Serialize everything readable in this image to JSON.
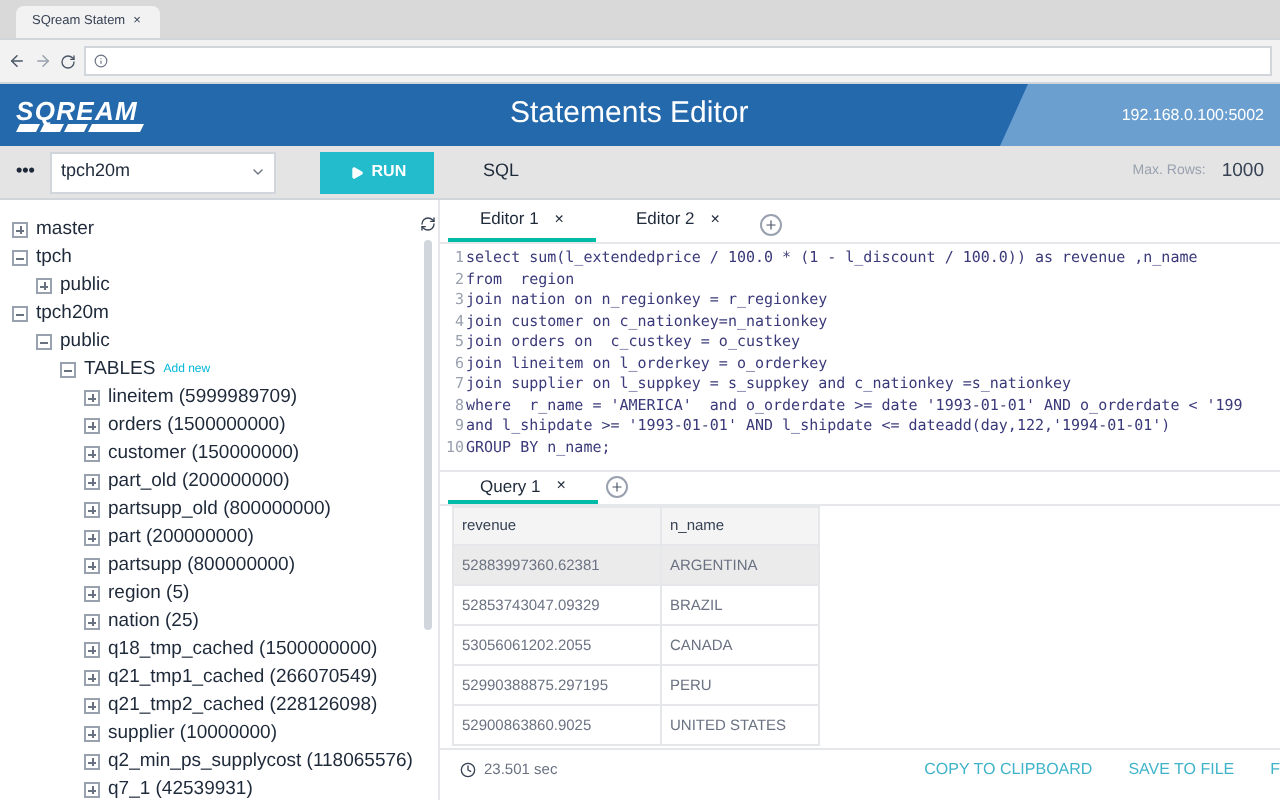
{
  "browser": {
    "tab_title": "SQream Statem",
    "close": "×"
  },
  "header": {
    "logo": "SQREAM",
    "title": "Statements Editor",
    "host": "192.168.0.100:5002"
  },
  "toolbar": {
    "more": "•••",
    "database": "tpch20m",
    "run": "RUN",
    "mode": "SQL",
    "max_rows_label": "Max. Rows:",
    "max_rows": "1000"
  },
  "tree": [
    {
      "label": "master",
      "expanded": false
    },
    {
      "label": "tpch",
      "expanded": true,
      "children": [
        {
          "label": "public",
          "expanded": false
        }
      ]
    },
    {
      "label": "tpch20m",
      "expanded": true,
      "children": [
        {
          "label": "public",
          "expanded": true,
          "children": [
            {
              "label": "TABLES",
              "link": "Add new",
              "expanded": true,
              "children": [
                {
                  "label": "lineitem (5999989709)",
                  "expanded": false
                },
                {
                  "label": "orders (1500000000)",
                  "expanded": false
                },
                {
                  "label": "customer (150000000)",
                  "expanded": false
                },
                {
                  "label": "part_old (200000000)",
                  "expanded": false
                },
                {
                  "label": "partsupp_old (800000000)",
                  "expanded": false
                },
                {
                  "label": "part (200000000)",
                  "expanded": false
                },
                {
                  "label": "partsupp (800000000)",
                  "expanded": false
                },
                {
                  "label": "region (5)",
                  "expanded": false
                },
                {
                  "label": "nation (25)",
                  "expanded": false
                },
                {
                  "label": "q18_tmp_cached (1500000000)",
                  "expanded": false
                },
                {
                  "label": "q21_tmp1_cached (266070549)",
                  "expanded": false
                },
                {
                  "label": "q21_tmp2_cached (228126098)",
                  "expanded": false
                },
                {
                  "label": "supplier (10000000)",
                  "expanded": false
                },
                {
                  "label": "q2_min_ps_supplycost (118065576)",
                  "expanded": false
                },
                {
                  "label": "q7_1 (42539931)",
                  "expanded": false
                }
              ]
            }
          ]
        }
      ]
    }
  ],
  "editor_tabs": [
    {
      "label": "Editor 1",
      "close": "×",
      "selected": true
    },
    {
      "label": "Editor 2",
      "close": "×",
      "selected": false
    }
  ],
  "code": [
    {
      "n": "1",
      "text": "select sum(l_extendedprice / 100.0 * (1 - l_discount / 100.0)) as revenue ,n_name"
    },
    {
      "n": "2",
      "text": "from  region"
    },
    {
      "n": "3",
      "text": "join nation on n_regionkey = r_regionkey"
    },
    {
      "n": "4",
      "text": "join customer on c_nationkey=n_nationkey"
    },
    {
      "n": "5",
      "text": "join orders on  c_custkey = o_custkey"
    },
    {
      "n": "6",
      "text": "join lineitem on l_orderkey = o_orderkey"
    },
    {
      "n": "7",
      "text": "join supplier on l_suppkey = s_suppkey and c_nationkey =s_nationkey"
    },
    {
      "n": "8",
      "text": "where  r_name = 'AMERICA'  and o_orderdate >= date '1993-01-01' AND o_orderdate < '199"
    },
    {
      "n": "9",
      "text": "and l_shipdate >= '1993-01-01' AND l_shipdate <= dateadd(day,122,'1994-01-01')"
    },
    {
      "n": "10",
      "text": "GROUP BY n_name;"
    }
  ],
  "result_tabs": [
    {
      "label": "Query 1",
      "close": "×",
      "selected": true
    }
  ],
  "table": {
    "columns": [
      "revenue",
      "n_name"
    ],
    "rows": [
      {
        "cells": [
          "52883997360.62381",
          "ARGENTINA"
        ],
        "selected": true
      },
      {
        "cells": [
          "52853743047.09329",
          "BRAZIL"
        ],
        "selected": false
      },
      {
        "cells": [
          "53056061202.2055",
          "CANADA"
        ],
        "selected": false
      },
      {
        "cells": [
          "52990388875.297195",
          "PERU"
        ],
        "selected": false
      },
      {
        "cells": [
          "52900863860.9025",
          "UNITED STATES"
        ],
        "selected": false
      }
    ]
  },
  "footer": {
    "elapsed": "23.501 sec",
    "actions": [
      "COPY TO CLIPBOARD",
      "SAVE TO FILE",
      "F"
    ]
  }
}
